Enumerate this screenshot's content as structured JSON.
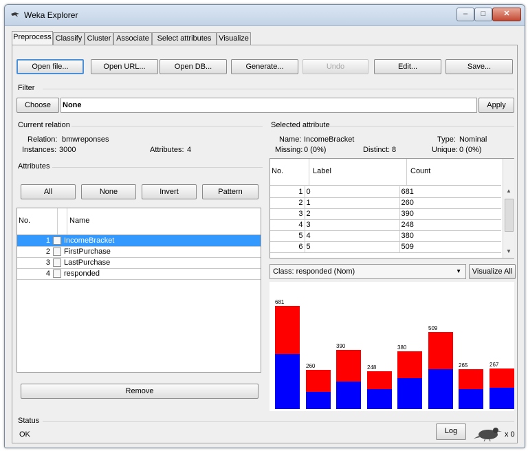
{
  "window": {
    "title": "Weka Explorer",
    "minimize": "–",
    "maximize": "□",
    "close": "✕"
  },
  "tabs": [
    "Preprocess",
    "Classify",
    "Cluster",
    "Associate",
    "Select attributes",
    "Visualize"
  ],
  "toolbar": {
    "open_file": "Open file...",
    "open_url": "Open URL...",
    "open_db": "Open DB...",
    "generate": "Generate...",
    "undo": "Undo",
    "edit": "Edit...",
    "save": "Save..."
  },
  "filter": {
    "heading": "Filter",
    "choose": "Choose",
    "value": "None",
    "apply": "Apply"
  },
  "relation": {
    "heading": "Current relation",
    "relation_label": "Relation:",
    "relation_value": "bmwreponses",
    "instances_label": "Instances:",
    "instances_value": "3000",
    "attributes_label": "Attributes:",
    "attributes_value": "4"
  },
  "attributes": {
    "heading": "Attributes",
    "all": "All",
    "none": "None",
    "invert": "Invert",
    "pattern": "Pattern",
    "col_no": "No.",
    "col_name": "Name",
    "rows": [
      {
        "no": "1",
        "name": "IncomeBracket"
      },
      {
        "no": "2",
        "name": "FirstPurchase"
      },
      {
        "no": "3",
        "name": "LastPurchase"
      },
      {
        "no": "4",
        "name": "responded"
      }
    ],
    "remove": "Remove"
  },
  "selected": {
    "heading": "Selected attribute",
    "name_label": "Name:",
    "name_value": "IncomeBracket",
    "type_label": "Type:",
    "type_value": "Nominal",
    "missing_label": "Missing:",
    "missing_value": "0 (0%)",
    "distinct_label": "Distinct:",
    "distinct_value": "8",
    "unique_label": "Unique:",
    "unique_value": "0 (0%)",
    "col_no": "No.",
    "col_label": "Label",
    "col_count": "Count",
    "rows": [
      {
        "no": "1",
        "label": "0",
        "count": "681"
      },
      {
        "no": "2",
        "label": "1",
        "count": "260"
      },
      {
        "no": "3",
        "label": "2",
        "count": "390"
      },
      {
        "no": "4",
        "label": "3",
        "count": "248"
      },
      {
        "no": "5",
        "label": "4",
        "count": "380"
      },
      {
        "no": "6",
        "label": "5",
        "count": "509"
      }
    ]
  },
  "class_select": {
    "value": "Class: responded (Nom)",
    "visualize_all": "Visualize All"
  },
  "histogram": {
    "labels": [
      "681",
      "260",
      "390",
      "248",
      "380",
      "509",
      "265",
      "267"
    ],
    "totals": [
      681,
      260,
      390,
      248,
      380,
      509,
      265,
      267
    ],
    "blue_fraction": [
      0.53,
      0.44,
      0.46,
      0.53,
      0.53,
      0.52,
      0.5,
      0.53
    ],
    "colors": {
      "red": "#ff0000",
      "blue": "#0000ff"
    }
  },
  "status": {
    "heading": "Status",
    "text": "OK",
    "log": "Log",
    "count": "x 0"
  }
}
